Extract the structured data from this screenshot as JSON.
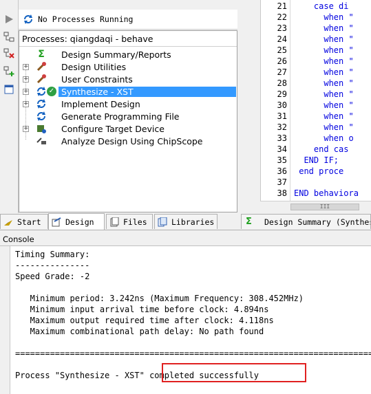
{
  "status": {
    "text": "No Processes Running"
  },
  "processes": {
    "header": "Processes: qiangdaqi - behave",
    "items": [
      {
        "label": "Design Summary/Reports",
        "icon": "sigma-icon",
        "expandable": false
      },
      {
        "label": "Design Utilities",
        "icon": "tools-icon",
        "expandable": true
      },
      {
        "label": "User Constraints",
        "icon": "constraints-icon",
        "expandable": true
      },
      {
        "label": "Synthesize - XST",
        "icon": "refresh-icon",
        "expandable": true,
        "selected": true,
        "status": "check-icon"
      },
      {
        "label": "Implement Design",
        "icon": "refresh-icon",
        "expandable": true
      },
      {
        "label": "Generate Programming File",
        "icon": "refresh-icon",
        "expandable": false
      },
      {
        "label": "Configure Target Device",
        "icon": "device-icon",
        "expandable": true
      },
      {
        "label": "Analyze Design Using ChipScope",
        "icon": "chipscope-icon",
        "expandable": false
      }
    ]
  },
  "editor": {
    "lines": [
      {
        "num": "21",
        "code": "    case di"
      },
      {
        "num": "22",
        "code": "      when \""
      },
      {
        "num": "23",
        "code": "      when \""
      },
      {
        "num": "24",
        "code": "      when \""
      },
      {
        "num": "25",
        "code": "      when \""
      },
      {
        "num": "26",
        "code": "      when \""
      },
      {
        "num": "27",
        "code": "      when \""
      },
      {
        "num": "28",
        "code": "      when \""
      },
      {
        "num": "29",
        "code": "      when \""
      },
      {
        "num": "30",
        "code": "      when \""
      },
      {
        "num": "31",
        "code": "      when \""
      },
      {
        "num": "32",
        "code": "      when \""
      },
      {
        "num": "33",
        "code": "      when o"
      },
      {
        "num": "34",
        "code": "    end cas"
      },
      {
        "num": "35",
        "code": "  END IF;"
      },
      {
        "num": "36",
        "code": " end proce"
      },
      {
        "num": "37",
        "code": ""
      },
      {
        "num": "38",
        "code": "END behaviora"
      }
    ],
    "scroll_thumb": "III"
  },
  "tabs": {
    "start": "Start",
    "design": "Design",
    "files": "Files",
    "libraries": "Libraries",
    "summary": "Design Summary (Synthesi"
  },
  "console": {
    "title": "Console",
    "lines": [
      "Timing Summary:",
      "---------------",
      "Speed Grade: -2",
      "",
      "   Minimum period: 3.242ns (Maximum Frequency: 308.452MHz)",
      "   Minimum input arrival time before clock: 4.894ns",
      "   Maximum output required time after clock: 4.118ns",
      "   Maximum combinational path delay: No path found",
      "",
      "=========================================================================",
      "",
      "Process \"Synthesize - XST\" completed successfully"
    ]
  },
  "colors": {
    "selection": "#3399ff",
    "keyword": "#0000e0",
    "highlight_box": "#e02020"
  }
}
